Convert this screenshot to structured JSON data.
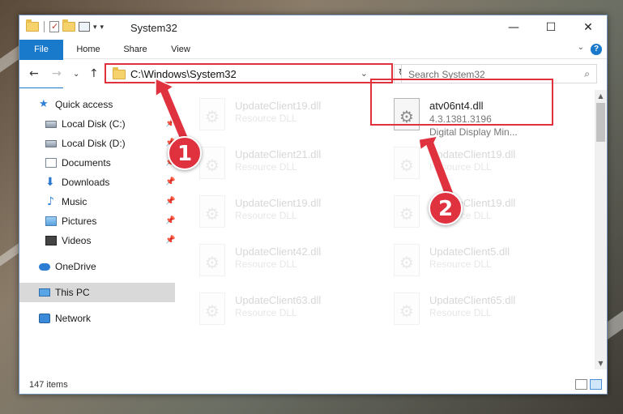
{
  "window": {
    "title": "System32",
    "controls": {
      "minimize": "—",
      "maximize": "☐",
      "close": "✕"
    }
  },
  "ribbon": {
    "tabs": [
      "File",
      "Home",
      "Share",
      "View"
    ],
    "help": "?",
    "collapse": "⌄"
  },
  "nav": {
    "back": "←",
    "forward": "→",
    "recent": "⌄",
    "up": "↑",
    "address": "C:\\Windows\\System32",
    "address_dropdown": "⌄",
    "refresh": "↻",
    "search_placeholder": "Search System32",
    "search_icon": "⌕"
  },
  "sidebar": {
    "pin_icon": "📌",
    "items": [
      {
        "label": "Quick access",
        "icon": "star-icon",
        "glyph": "★"
      },
      {
        "label": "Local Disk (C:)",
        "icon": "disk-icon",
        "pinned": true
      },
      {
        "label": "Local Disk (D:)",
        "icon": "disk-icon",
        "pinned": true
      },
      {
        "label": "Documents",
        "icon": "documents-icon",
        "pinned": true
      },
      {
        "label": "Downloads",
        "icon": "downloads-icon",
        "glyph": "⬇",
        "pinned": true
      },
      {
        "label": "Music",
        "icon": "music-icon",
        "glyph": "♪",
        "pinned": true
      },
      {
        "label": "Pictures",
        "icon": "pictures-icon",
        "pinned": true
      },
      {
        "label": "Videos",
        "icon": "videos-icon",
        "pinned": true
      },
      {
        "label": "OneDrive",
        "icon": "onedrive-icon"
      },
      {
        "label": "This PC",
        "icon": "computer-icon",
        "selected": true
      },
      {
        "label": "Network",
        "icon": "network-icon"
      }
    ]
  },
  "files": {
    "focus": {
      "name": "atv06nt4.dll",
      "version": "4.3.1381.3196",
      "description": "Digital Display Min..."
    },
    "faded": [
      {
        "name": "UpdateClient19.dll",
        "type": "Resource DLL"
      },
      {
        "name": "UpdateClient21.dll",
        "type": "Resource DLL"
      },
      {
        "name": "UpdateClient19.dll",
        "type": "Resource DLL"
      },
      {
        "name": "UpdateClient19.dll",
        "type": "Resource DLL"
      },
      {
        "name": "UpdateClient19.dll",
        "type": "Resource DLL"
      },
      {
        "name": "UpdateClient42.dll",
        "type": "Resource DLL"
      },
      {
        "name": "UpdateClient5.dll",
        "type": "Resource DLL"
      },
      {
        "name": "UpdateClient63.dll",
        "type": "Resource DLL"
      },
      {
        "name": "UpdateClient65.dll",
        "type": "Resource DLL"
      }
    ]
  },
  "scrollbar": {
    "up": "▲",
    "down": "▼"
  },
  "status": {
    "count": "147 items"
  },
  "annotations": {
    "marker1": "1",
    "marker2": "2",
    "color": "#e0313f"
  }
}
